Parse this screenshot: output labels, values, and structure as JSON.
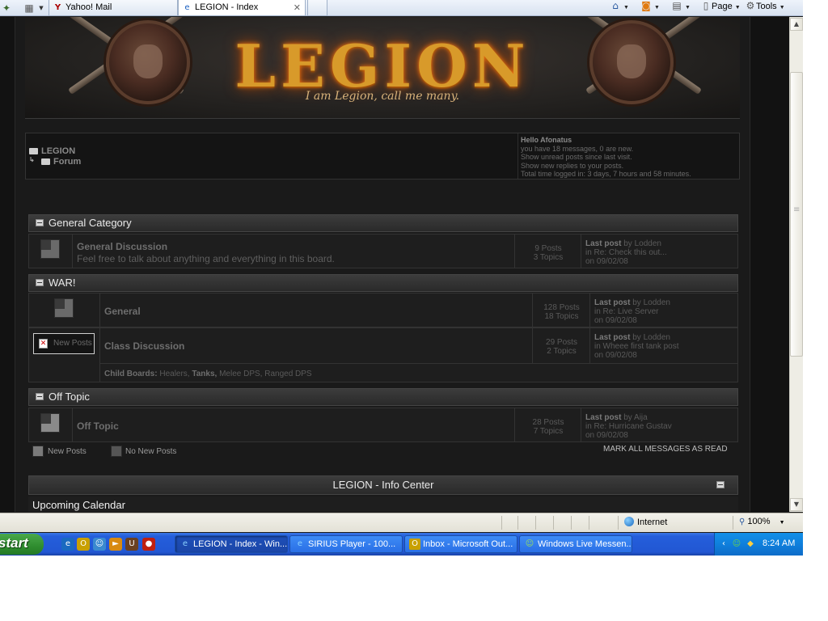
{
  "browser": {
    "tabs": [
      {
        "label": "Yahoo! Mail",
        "favicon": "yahoo-icon",
        "active": false
      },
      {
        "label": "LEGION - Index",
        "favicon": "ie-page-icon",
        "active": true
      }
    ],
    "commands": {
      "page_label": "Page",
      "tools_label": "Tools"
    }
  },
  "banner": {
    "logo_text": "LEGION",
    "tagline": "I am Legion, call me many."
  },
  "breadcrumb": {
    "root": "LEGION",
    "child": "Forum"
  },
  "user_info": {
    "hello": "Hello Afonatus",
    "messages": "you have 18 messages, 0 are new.",
    "unread": "Show unread posts since last visit.",
    "replies": "Show new replies to your posts.",
    "time_logged": "Total time logged in: 3 days, 7 hours and 58 minutes."
  },
  "categories": [
    {
      "name": "General Category",
      "boards": [
        {
          "title": "General Discussion",
          "description": "Feel free to talk about anything and everything in this board.",
          "posts": "9 Posts",
          "topics": "3 Topics",
          "last_post_label": "Last post",
          "last_post_by": "by Lodden",
          "last_post_in": "in Re: Check this out...",
          "last_post_on": "on 09/02/08"
        }
      ]
    },
    {
      "name": "WAR!",
      "boards": [
        {
          "title": "General",
          "posts": "128 Posts",
          "topics": "18 Topics",
          "last_post_label": "Last post",
          "last_post_by": "by Lodden",
          "last_post_in": "in Re: Live Server",
          "last_post_on": "on 09/02/08"
        },
        {
          "title": "Class Discussion",
          "new_posts_image_alt": "New Posts",
          "posts": "29 Posts",
          "topics": "2 Topics",
          "last_post_label": "Last post",
          "last_post_by": "by Lodden",
          "last_post_in": "in Wheee first tank post",
          "last_post_on": "on 09/02/08",
          "child_boards_label": "Child Boards:",
          "child_boards": [
            "Healers,",
            "Tanks,",
            "Melee DPS,",
            "Ranged DPS"
          ]
        }
      ]
    },
    {
      "name": "Off Topic",
      "boards": [
        {
          "title": "Off Topic",
          "posts": "28 Posts",
          "topics": "7 Topics",
          "last_post_label": "Last post",
          "last_post_by": "by Aija",
          "last_post_in": "in Re: Hurricane Gustav",
          "last_post_on": "on 09/02/08"
        }
      ]
    }
  ],
  "legend": {
    "new_posts": "New Posts",
    "no_new_posts": "No New Posts",
    "mark_all": "MARK ALL MESSAGES AS READ"
  },
  "info_center": {
    "title": "LEGION - Info Center",
    "calendar_label": "Upcoming Calendar"
  },
  "status_bar": {
    "zone": "Internet",
    "zoom": "100%"
  },
  "taskbar": {
    "start_label": "start",
    "buttons": [
      {
        "label": "LEGION - Index - Win...",
        "icon": "ie-icon",
        "active": true
      },
      {
        "label": "SIRIUS Player - 100...",
        "icon": "ie-icon",
        "active": false
      },
      {
        "label": "Inbox - Microsoft Out...",
        "icon": "outlook-icon",
        "active": false
      },
      {
        "label": "Windows Live Messen...",
        "icon": "messenger-icon",
        "active": false
      }
    ],
    "clock": "8:24 AM"
  }
}
